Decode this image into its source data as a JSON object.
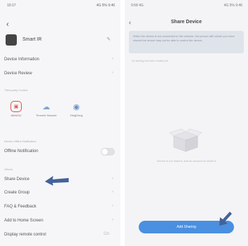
{
  "left": {
    "status_time": "10:17",
    "status_right": "4G 5%  9:46",
    "device_name": "Smart IR",
    "items": {
      "device_information": "Device Information",
      "device_review": "Device Review",
      "offline_notification": "Offline Notification",
      "share_device": "Share Device",
      "create_group": "Create Group",
      "faq_feedback": "FAQ & Feedback",
      "add_home_screen": "Add to Home Screen",
      "display_remote_control": "Display remote control"
    },
    "display_remote_value": "On",
    "section_headers": {
      "shortcuts": "Third-party Control",
      "offline": "Device Offline Notification",
      "others": "Others"
    },
    "shortcuts": [
      {
        "label": "AMAZIU",
        "icon": "remote-icon"
      },
      {
        "label": "Tencent Xiaowei",
        "icon": "cloud-icon"
      },
      {
        "label": "DingDong",
        "icon": "dingdong-icon"
      }
    ],
    "offline_toggle_on": false
  },
  "right": {
    "status_time": "9:58 4G",
    "status_right": "4G 5%  9:46",
    "title": "Share Device",
    "notice": "When the device is not connected to the network, the person with whom you have shared the device may not be able to control the device.",
    "empty_hint": "No sharing has been created yet",
    "empty_text": "Device is not shared, add an account to share it",
    "add_button": "Add Sharing"
  },
  "colors": {
    "accent": "#4a8fe0",
    "annotation_arrow": "#44619a"
  }
}
